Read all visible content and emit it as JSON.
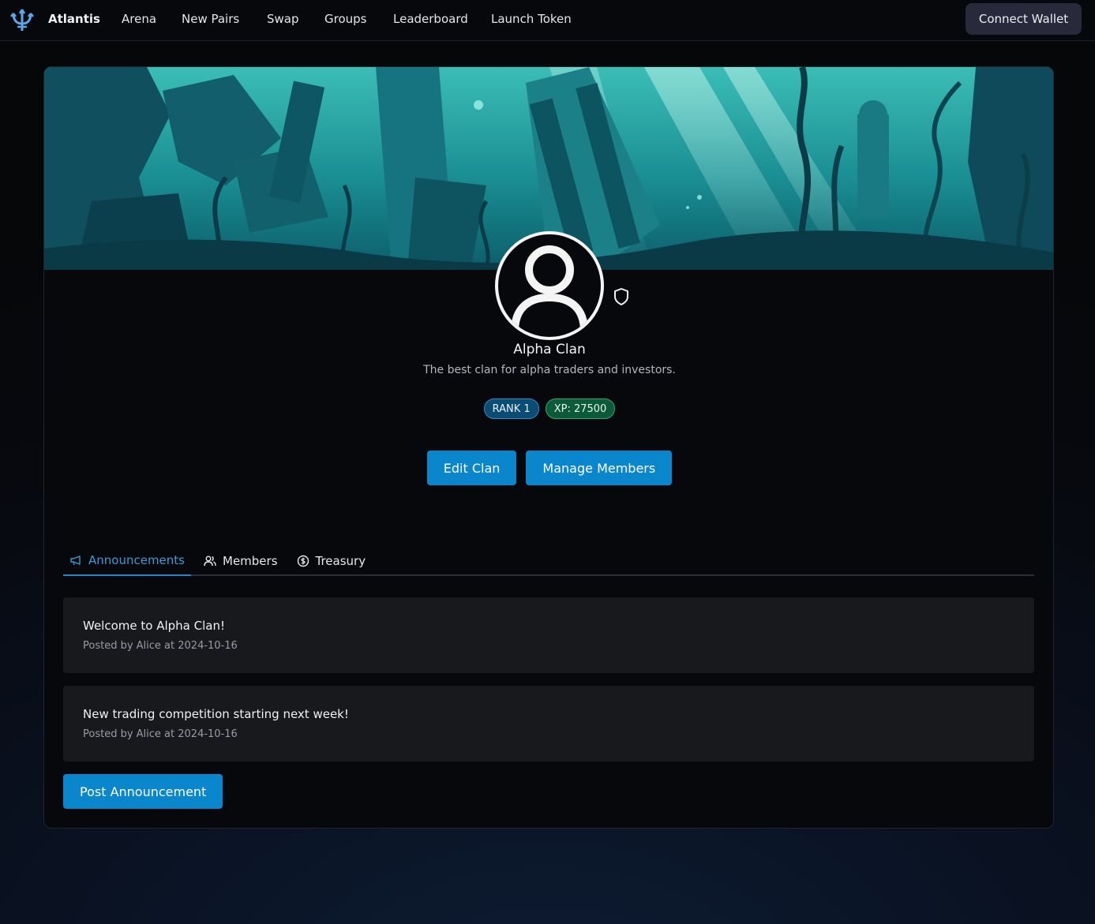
{
  "nav": {
    "brand": "Atlantis",
    "links": [
      "Arena",
      "New Pairs",
      "Swap",
      "Groups",
      "Leaderboard",
      "Launch Token"
    ],
    "connect_wallet": "Connect Wallet"
  },
  "clan": {
    "name": "Alpha Clan",
    "description": "The best clan for alpha traders and investors.",
    "rank_badge": "RANK 1",
    "xp_badge": "XP: 27500",
    "edit_button": "Edit Clan",
    "manage_button": "Manage Members"
  },
  "tabs": [
    {
      "label": "Announcements",
      "icon": "megaphone-icon",
      "active": true
    },
    {
      "label": "Members",
      "icon": "users-icon",
      "active": false
    },
    {
      "label": "Treasury",
      "icon": "dollar-circle-icon",
      "active": false
    }
  ],
  "announcements": [
    {
      "title": "Welcome to Alpha Clan!",
      "meta": "Posted by Alice at 2024-10-16"
    },
    {
      "title": "New trading competition starting next week!",
      "meta": "Posted by Alice at 2024-10-16"
    }
  ],
  "post_button": "Post Announcement",
  "colors": {
    "accent": "#0a86cc",
    "active_tab": "#3b9bd8",
    "rank_badge": "#0b4c74",
    "xp_badge": "#0d5a3a",
    "wallet_button": "#282a3b"
  }
}
